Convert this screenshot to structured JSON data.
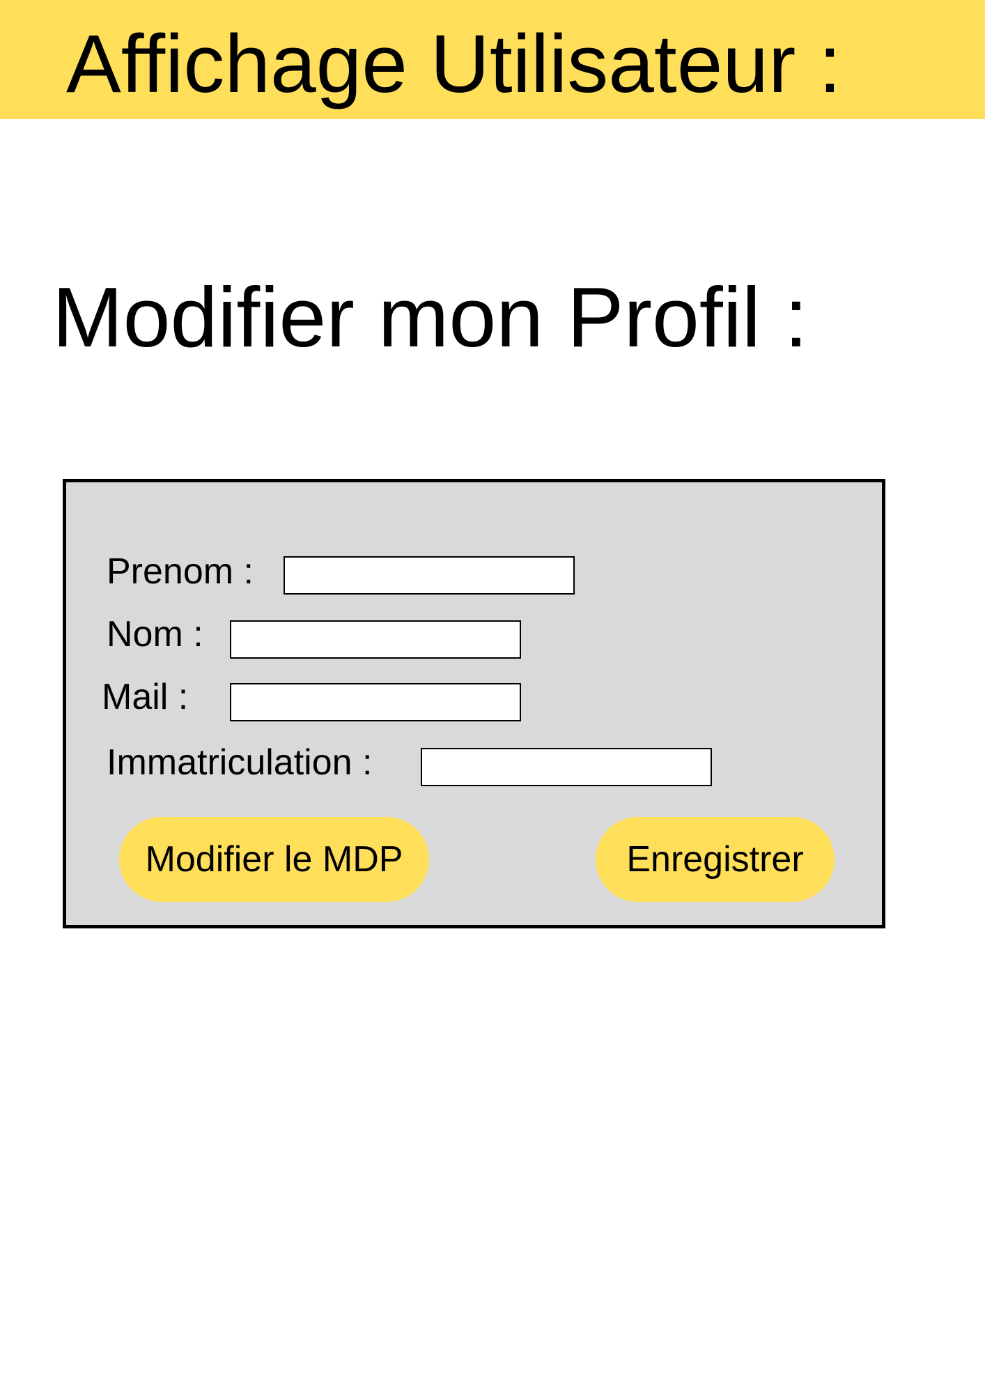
{
  "header": {
    "title": "Affichage Utilisateur :"
  },
  "page": {
    "title": "Modifier mon Profil :"
  },
  "form": {
    "fields": [
      {
        "label": "Prenom :",
        "value": ""
      },
      {
        "label": "Nom :",
        "value": ""
      },
      {
        "label": "Mail :",
        "value": ""
      },
      {
        "label": "Immatriculation :",
        "value": ""
      }
    ],
    "change_password_label": "Modifier le MDP",
    "save_label": "Enregistrer"
  },
  "colors": {
    "accent": "#FFDE59",
    "panel": "#D9D9D9"
  }
}
